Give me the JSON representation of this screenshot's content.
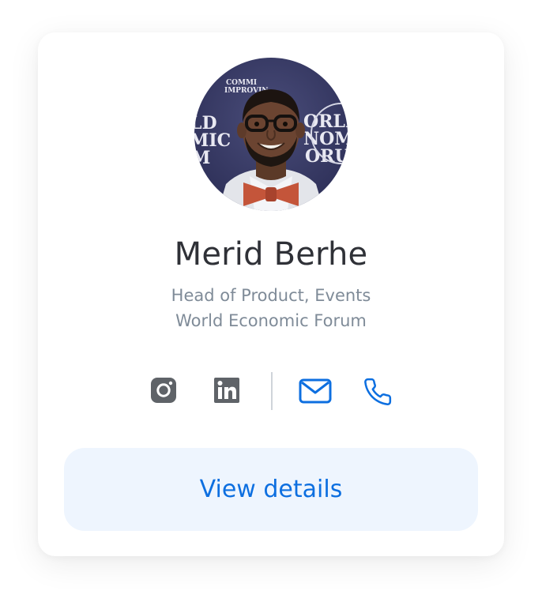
{
  "profile": {
    "name": "Merid Berhe",
    "role": "Head of Product, Events",
    "company": "World Economic Forum",
    "avatar_backdrop_left": "WORLD ECONOMIC FORUM",
    "avatar_backdrop_right": "WORLD ECONOMIC FORUM"
  },
  "socials": [
    {
      "icon": "instagram-icon"
    },
    {
      "icon": "linkedin-icon"
    },
    {
      "icon": "mail-icon"
    },
    {
      "icon": "phone-icon"
    }
  ],
  "actions": {
    "view_details_label": "View details"
  },
  "colors": {
    "accent": "#0d6fe0",
    "button_bg": "#eef5fe",
    "icon_gray": "#5f6368",
    "name": "#2f3137",
    "subtitle": "#7f8b98"
  }
}
